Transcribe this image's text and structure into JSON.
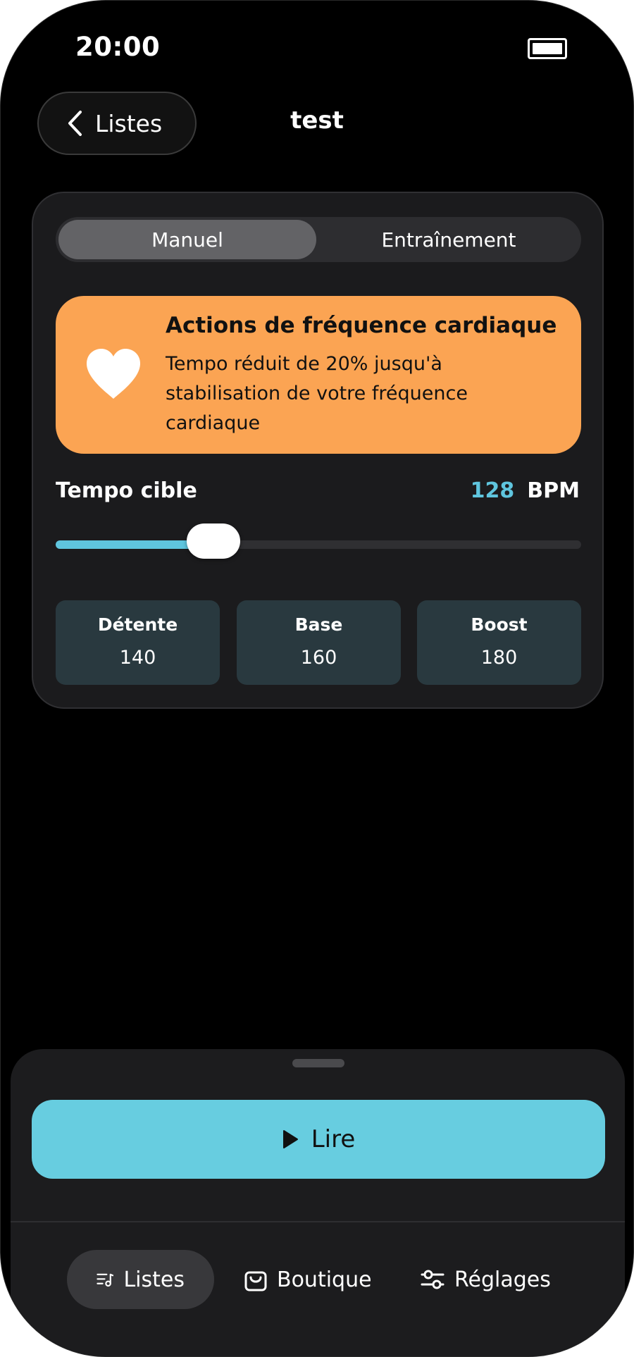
{
  "status_bar": {
    "time": "20:00"
  },
  "header": {
    "back_label": "Listes",
    "title": "test"
  },
  "mode_tabs": [
    {
      "label": "Manuel",
      "selected": true
    },
    {
      "label": "Entraînement",
      "selected": false
    }
  ],
  "heart_rate_banner": {
    "icon": "heart-icon",
    "title": "Actions de fréquence cardiaque",
    "body": "Tempo réduit de 20% jusqu'à stabilisation de votre fréquence cardiaque",
    "color": "#FBA453"
  },
  "tempo": {
    "label": "Tempo cible",
    "value": "128",
    "unit": "BPM",
    "slider_level": 0.3
  },
  "presets": [
    {
      "name": "Détente",
      "value": "140"
    },
    {
      "name": "Base",
      "value": "160"
    },
    {
      "name": "Boost",
      "value": "180"
    }
  ],
  "play_button": {
    "label": "Lire",
    "icon": "play-icon",
    "color": "#67CDE0"
  },
  "tab_bar": [
    {
      "label": "Listes",
      "icon": "playlist-icon",
      "active": true
    },
    {
      "label": "Boutique",
      "icon": "shopping-bag-icon",
      "active": false
    },
    {
      "label": "Réglages",
      "icon": "sliders-icon",
      "active": false
    }
  ],
  "colors": {
    "accent": "#5FC5DE",
    "background": "#000000",
    "card": "#1b1b1d"
  }
}
